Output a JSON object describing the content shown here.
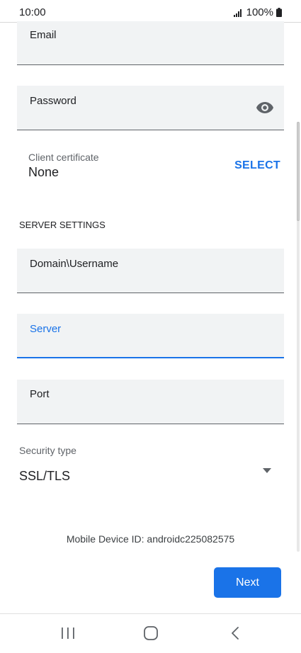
{
  "status_bar": {
    "time": "10:00",
    "battery_text": "100%"
  },
  "form": {
    "email_label": "Email",
    "password_label": "Password",
    "client_certificate": {
      "label": "Client certificate",
      "value": "None",
      "select_label": "SELECT"
    },
    "server_settings_header": "SERVER SETTINGS",
    "domain_username_label": "Domain\\Username",
    "server_label": "Server",
    "port_label": "Port",
    "security_type": {
      "label": "Security type",
      "value": "SSL/TLS"
    },
    "device_id_text": "Mobile Device ID: androidc225082575",
    "next_label": "Next"
  },
  "colors": {
    "accent": "#1a73e8",
    "field_background": "#f1f3f4"
  },
  "icons": [
    "signal-icon",
    "battery-icon",
    "eye-icon",
    "dropdown-arrow-icon",
    "recents-icon",
    "home-icon",
    "back-icon"
  ]
}
